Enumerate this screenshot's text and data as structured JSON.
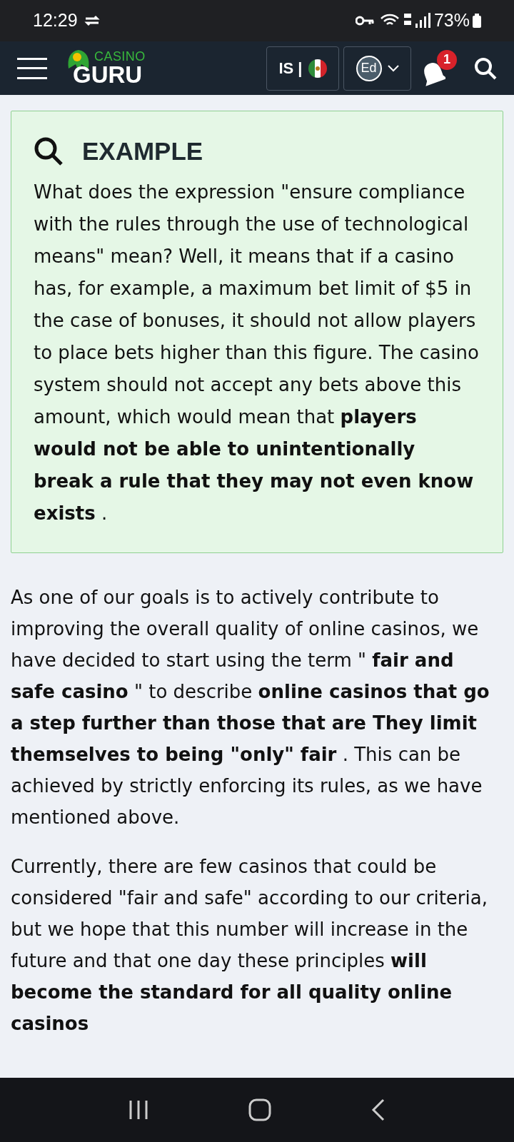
{
  "status_bar": {
    "time": "12:29",
    "battery": "73%"
  },
  "header": {
    "logo_top": "CASINO",
    "logo_bottom": "GURU",
    "language": "IS |",
    "avatar": "Ed",
    "notifications": "1"
  },
  "example": {
    "title": "EXAMPLE",
    "text": "What does the expression \"ensure compliance with the rules through the use of technological means\" mean? Well, it means that if a casino has, for example, a maximum bet limit of $5 in the case of bonuses, it should not allow players to place bets higher than this figure. The casino system should not accept any bets above this amount, which would mean that **players would not be able to unintentionally break a rule that they may not even know exists** ."
  },
  "paragraphs": [
    "As one of our goals is to actively contribute to improving the overall quality of online casinos, we have decided to start using the term \" **fair and safe casino** \" to describe **online casinos that go a step further than those that are They limit themselves to being \"only\" fair** . This can be achieved by strictly enforcing its rules, as we have mentioned above.",
    "Currently, there are few casinos that could be considered \"fair and safe\" according to our criteria, but we hope that this number will increase in the future and that one day these principles **will become the standard for all quality online casinos**"
  ]
}
